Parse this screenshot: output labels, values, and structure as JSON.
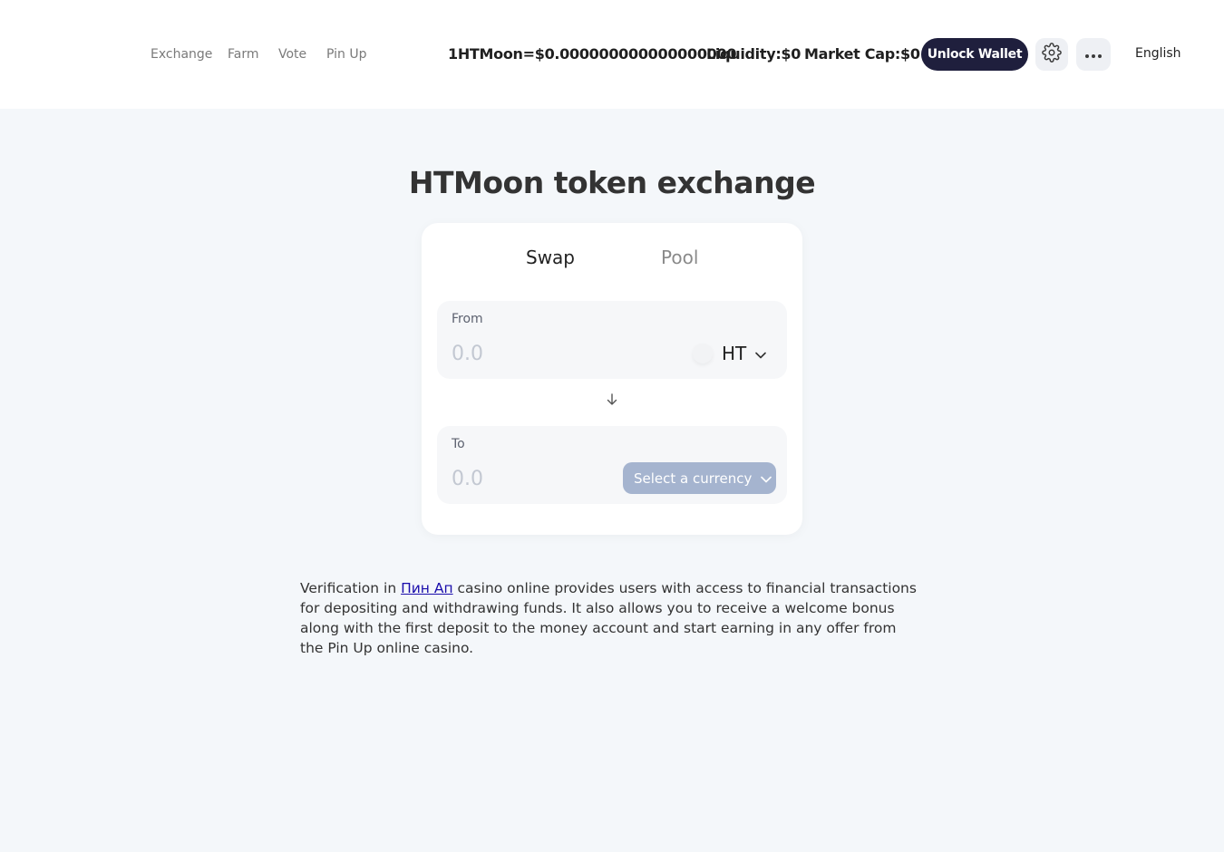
{
  "nav": {
    "items": [
      {
        "label": "Exchange"
      },
      {
        "label": "Farm"
      },
      {
        "label": "Vote"
      },
      {
        "label": "Pin Up"
      }
    ]
  },
  "stats": {
    "price": "1HTMoon=$0.000000000000000000",
    "liquidity": "Liquidity:$0",
    "market_cap": "Market Cap:$0"
  },
  "header": {
    "unlock_wallet_label": "Unlock Wallet",
    "settings_icon": "gear-icon",
    "more_icon": "more-dots-icon",
    "language": "English"
  },
  "main": {
    "title": "HTMoon token exchange",
    "tabs": [
      {
        "label": "Swap",
        "active": true
      },
      {
        "label": "Pool",
        "active": false
      }
    ],
    "from": {
      "label": "From",
      "placeholder": "0.0",
      "token": "HT"
    },
    "to": {
      "label": "To",
      "placeholder": "0.0",
      "select_label": "Select a currency"
    }
  },
  "description": {
    "before_link": "Verification in ",
    "link_text": "Пин Ап",
    "after_link": " casino online provides users with access to financial transactions for depositing and withdrawing funds. It also allows you to receive a welcome bonus along with the first deposit to the money account and start earning in any offer from the Pin Up online casino."
  },
  "colors": {
    "background": "#f4f7fa",
    "header_bg": "#ffffff",
    "unlock_button": "#1f1f3d",
    "select_currency_button": "#a5b4cf",
    "link": "#1a0dab"
  }
}
